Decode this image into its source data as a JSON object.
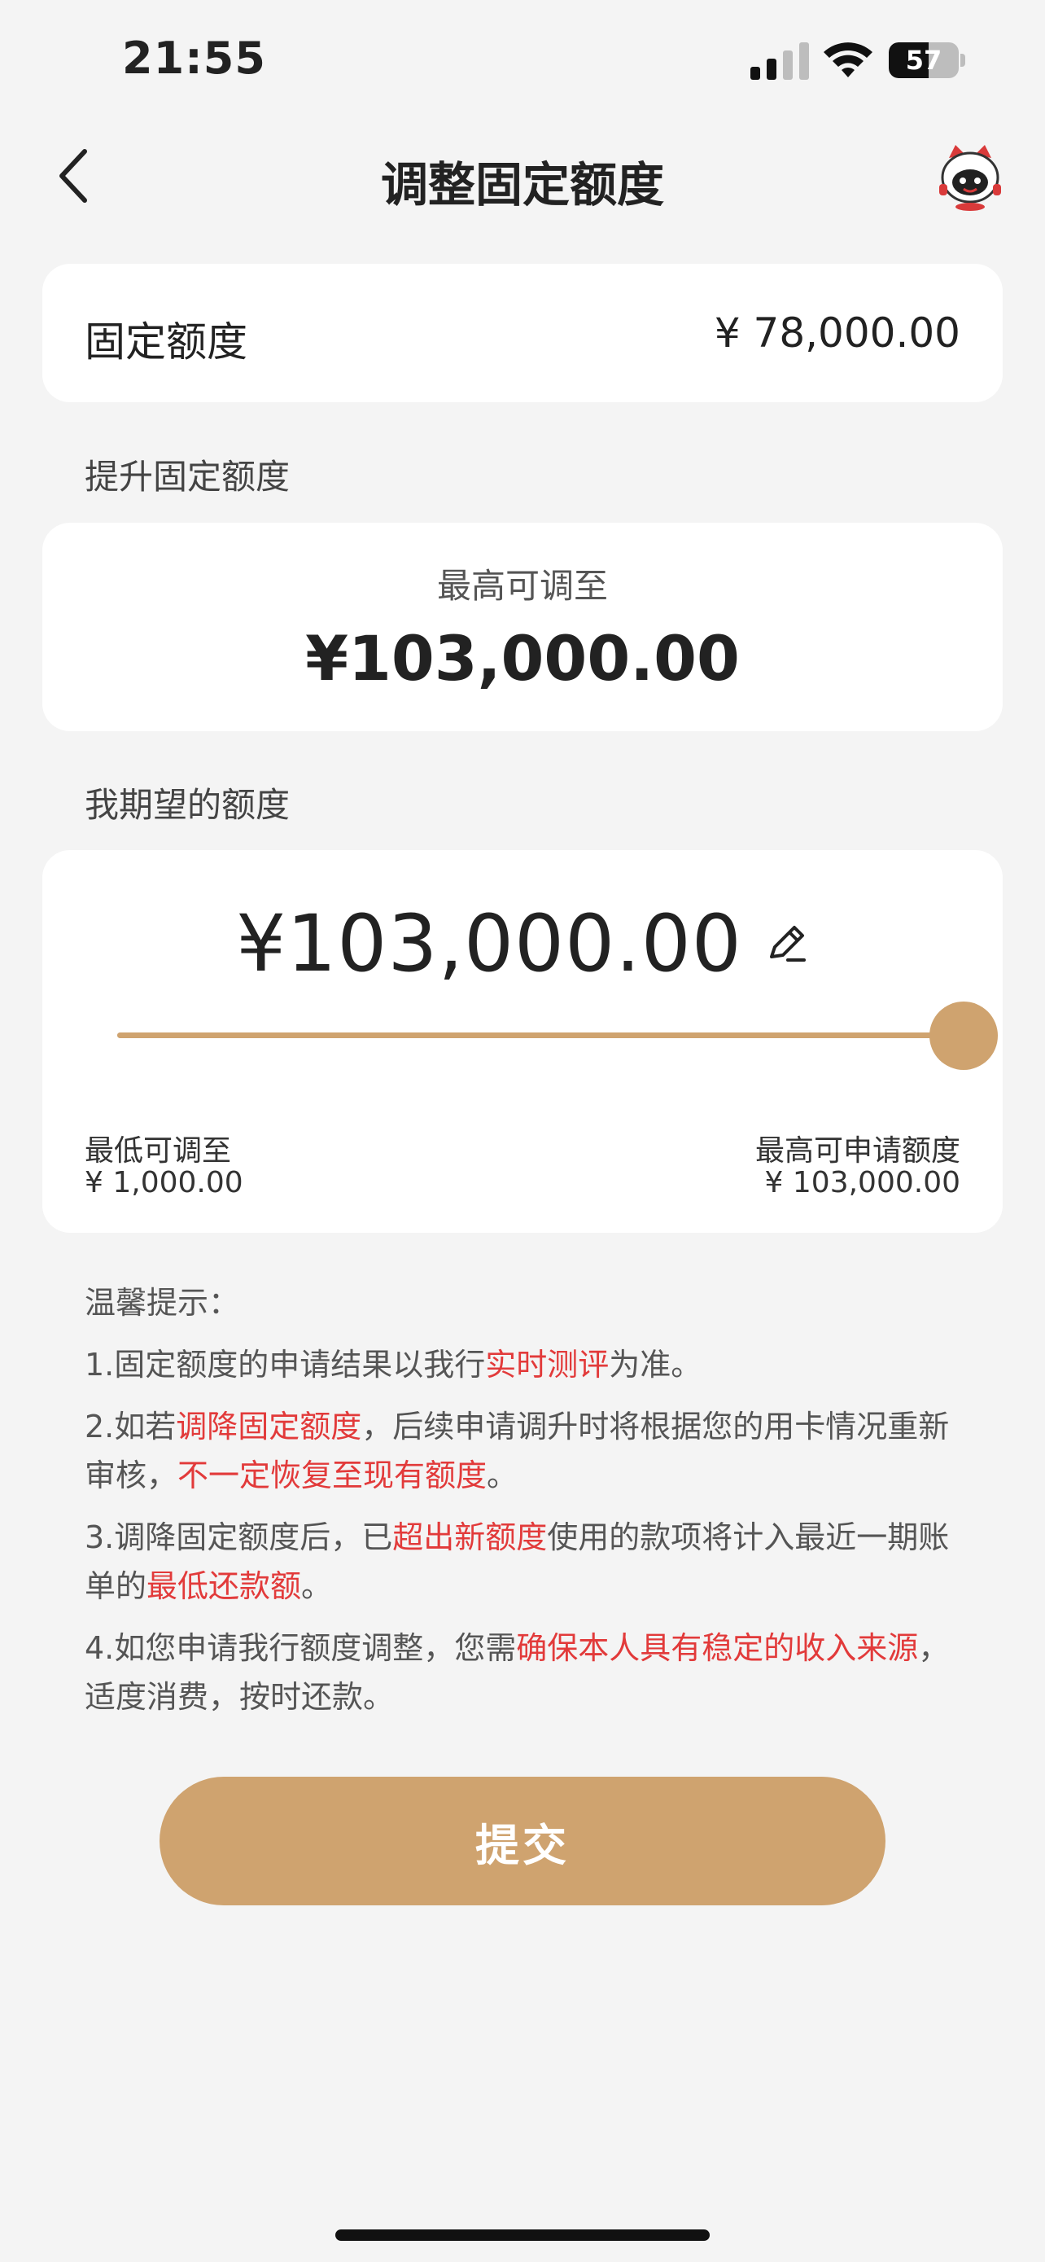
{
  "status_bar": {
    "time": "21:55",
    "battery": "57",
    "battery_level": 0.57
  },
  "nav": {
    "title": "调整固定额度"
  },
  "fixed": {
    "label": "固定额度",
    "value": "¥ 78,000.00"
  },
  "increase_section": {
    "label": "提升固定额度",
    "max_label": "最高可调至",
    "max_value": "¥103,000.00"
  },
  "desired_section": {
    "label": "我期望的额度",
    "value": "¥103,000.00",
    "slider_level": 1.0,
    "min_label": "最低可调至",
    "min_value": "¥ 1,000.00",
    "max_label": "最高可申请额度",
    "max_value": "¥ 103,000.00"
  },
  "tips": {
    "title": "温馨提示：",
    "items": [
      {
        "a": "1.固定额度的申请结果以我行",
        "b": "实时测评",
        "c": "为准。"
      },
      {
        "a": "2.如若",
        "b": "调降固定额度",
        "c": "，后续申请调升时将根据您的用卡情况重新审核，",
        "d": "不一定恢复至现有额度",
        "e": "。"
      },
      {
        "a": "3.调降固定额度后，已",
        "b": "超出新额度",
        "c": "使用的款项将计入最近一期账单的",
        "d": "最低还款额",
        "e": "。"
      },
      {
        "a": "4.如您申请我行额度调整，您需",
        "b": "确保本人具有稳定的收入来源",
        "c": "，适度消费，按时还款。"
      }
    ]
  },
  "submit": {
    "label": "提交"
  },
  "colors": {
    "accent": "#cfa36f",
    "warning": "#e23a3a",
    "background": "#f4f4f4"
  }
}
